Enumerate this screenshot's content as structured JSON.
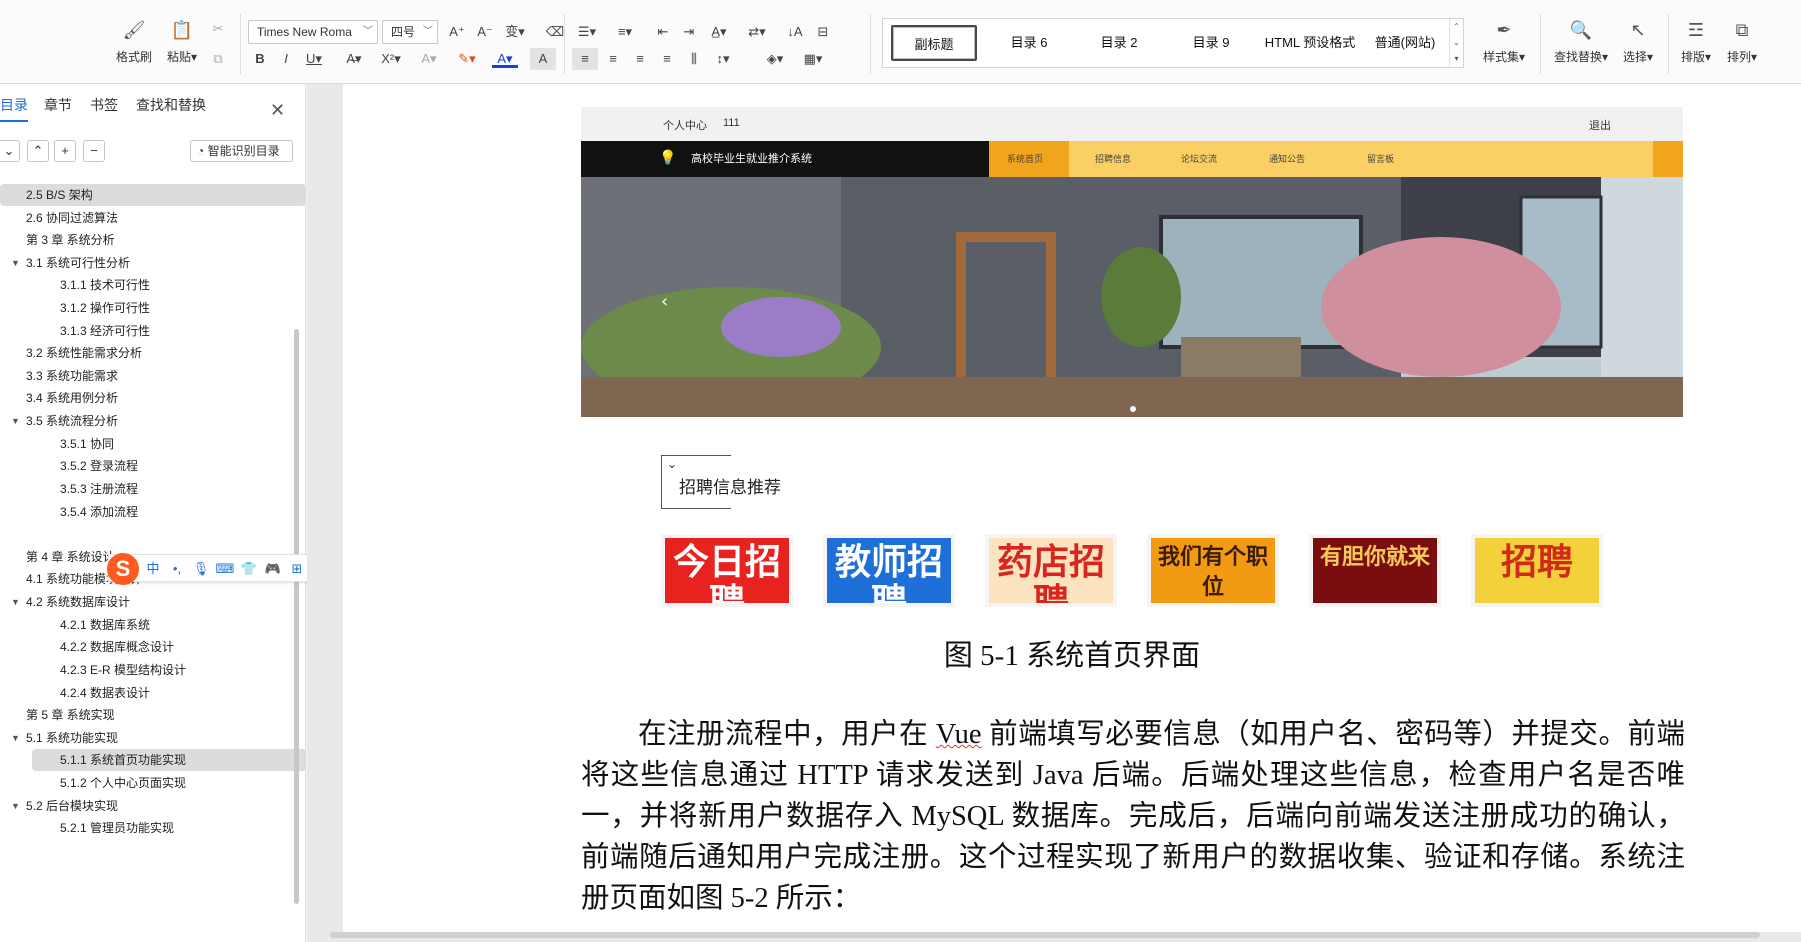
{
  "ribbon": {
    "format_painter": "格式刷",
    "paste": "粘贴",
    "font_name": "Times New Roma",
    "font_size": "四号",
    "styles": [
      "副标题",
      "目录 6",
      "目录 2",
      "目录 9",
      "HTML 预设格式",
      "普通(网站)"
    ],
    "style_set": "样式集",
    "find_replace": "查找替换",
    "select": "选择",
    "typeset": "排版",
    "arrange": "排列"
  },
  "sidebar": {
    "tabs": [
      "目录",
      "章节",
      "书签",
      "查找和替换"
    ],
    "smart_toc": "智能识别目录",
    "toc": [
      {
        "text": "2.5 B/S 架构",
        "level": 1,
        "highlight": true
      },
      {
        "text": "2.6 协同过滤算法",
        "level": 1
      },
      {
        "text": "第 3 章  系统分析",
        "level": 0
      },
      {
        "text": "3.1  系统可行性分析",
        "level": 1,
        "expanded": true
      },
      {
        "text": "3.1.1  技术可行性",
        "level": 2
      },
      {
        "text": "3.1.2  操作可行性",
        "level": 2
      },
      {
        "text": "3.1.3  经济可行性",
        "level": 2
      },
      {
        "text": "3.2 系统性能需求分析",
        "level": 1
      },
      {
        "text": "3.3 系统功能需求",
        "level": 1
      },
      {
        "text": "3.4  系统用例分析",
        "level": 1
      },
      {
        "text": "3.5  系统流程分析",
        "level": 1,
        "expanded": true
      },
      {
        "text": "3.5.1  协同",
        "level": 2
      },
      {
        "text": "3.5.2  登录流程",
        "level": 2
      },
      {
        "text": "3.5.3  注册流程",
        "level": 2
      },
      {
        "text": "3.5.4  添加流程",
        "level": 2
      },
      {
        "text": "",
        "level": 1
      },
      {
        "text": "第 4 章  系统设计",
        "level": 0
      },
      {
        "text": "4.1 系统功能模块设计",
        "level": 1
      },
      {
        "text": "4.2  系统数据库设计",
        "level": 1,
        "expanded": true
      },
      {
        "text": "4.2.1  数据库系统",
        "level": 2
      },
      {
        "text": "4.2.2  数据库概念设计",
        "level": 2
      },
      {
        "text": "4.2.3 E-R 模型结构设计",
        "level": 2
      },
      {
        "text": "4.2.4 数据表设计",
        "level": 2
      },
      {
        "text": "第 5 章  系统实现",
        "level": 0
      },
      {
        "text": "5.1 系统功能实现",
        "level": 1,
        "expanded": true
      },
      {
        "text": "5.1.1 系统首页功能实现",
        "level": 2,
        "highlight": true
      },
      {
        "text": "5.1.2 个人中心页面实现",
        "level": 2
      },
      {
        "text": "5.2 后台模块实现",
        "level": 1,
        "expanded": true
      },
      {
        "text": "5.2.1 管理员功能实现",
        "level": 2
      }
    ],
    "ime_chinese": "中"
  },
  "figure": {
    "top_link": "个人中心",
    "top_user": "111",
    "logout": "退出",
    "brand": "高校毕业生就业推介系统",
    "menu": [
      "系统首页",
      "招聘信息",
      "论坛交流",
      "通知公告",
      "留言板"
    ],
    "recommend_title": "招聘信息推荐",
    "posters": [
      {
        "text": "今日招聘",
        "bg": "#e8231f",
        "fg": "#ffffff"
      },
      {
        "text": "教师招聘",
        "bg": "#1e6fd8",
        "fg": "#ffffff"
      },
      {
        "text": "药店招聘",
        "bg": "#fbe3c0",
        "fg": "#d8261f"
      },
      {
        "text": "我们有个职位",
        "bg": "#f29b12",
        "fg": "#3a1c00"
      },
      {
        "text": "有胆你就来",
        "bg": "#7a0d0d",
        "fg": "#f7c85a"
      },
      {
        "text": "招聘",
        "bg": "#f3d13a",
        "fg": "#d02a1a"
      }
    ]
  },
  "document": {
    "caption": "图 5-1  系统首页界面",
    "paragraph_before": "在注册流程中，用户在 ",
    "paragraph_vue": "Vue",
    "paragraph_after": " 前端填写必要信息（如用户名、密码等）并提交。前端将这些信息通过 HTTP 请求发送到 Java 后端。后端处理这些信息，检查用户名是否唯一，并将新用户数据存入 MySQL 数据库。完成后，后端向前端发送注册成功的确认，前端随后通知用户完成注册。这个过程实现了新用户的数据收集、验证和存储。系统注册页面如图 5-2 所示："
  }
}
